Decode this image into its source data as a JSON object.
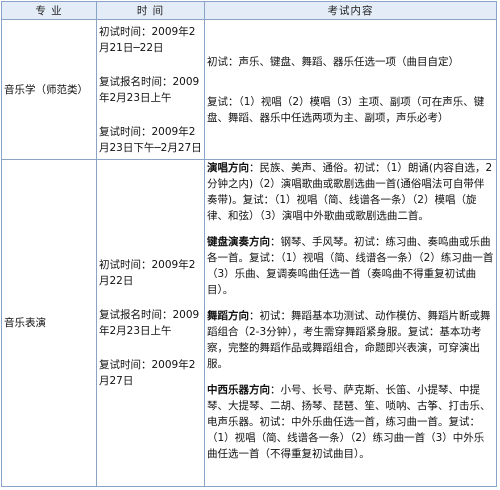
{
  "header": {
    "col_major": "专    业",
    "col_time": "时    间",
    "col_content": "考试内容"
  },
  "rows": [
    {
      "major": "音乐学（师范类）",
      "times": [
        "初试时间：2009年2月21日─22日",
        "复试报名时间：2009年2月23日上午",
        "复试时间：2009年2月23日下午─2月27日"
      ],
      "content": [
        "初试：声乐、键盘、舞蹈、器乐任选一项（曲目自定）",
        "复试：（1）视唱（2）模唱（3）主项、副项（可在声乐、键盘、舞蹈、器乐中任选两项为主、副项，声乐必考）"
      ]
    },
    {
      "major": "音乐表演",
      "times": [
        "初试时间：2009年2月22日",
        "复试报名时间：2009年2月23日上午",
        "复试时间：2009年2月27日"
      ],
      "sections": [
        {
          "title": "演唱方向",
          "text": "：民族、美声、通俗。初试：（1）朗诵(内容自选，2分钟之内)（2）演唱歌曲或歌剧选曲一首(通俗唱法可自带伴奏带)。复试：（1）视唱（简、线谱各一条）（2）模唱（旋律、和弦）（3）演唱中外歌曲或歌剧选曲二首。"
        },
        {
          "title": "键盘演奏方向",
          "text": "：钢琴、手风琴。初试：练习曲、奏鸣曲或乐曲各一首。复试：（1）视唱（简、线谱各一条）（2）练习曲一首（3）乐曲、复调奏鸣曲任选一首（奏鸣曲不得重复初试曲目）。"
        },
        {
          "title": "舞蹈方向",
          "text": "：初试：舞蹈基本功测试、动作模仿、舞蹈片断或舞蹈组合（2-3分钟），考生需穿舞蹈紧身服。复试：基本功考察，完整的舞蹈作品或舞蹈组合，命题即兴表演，可穿演出服。"
        },
        {
          "title": "中西乐器方向",
          "text": "：小号、长号、萨克斯、长笛、小提琴、中提琴、大提琴、二胡、扬琴、琵琶、笙、唢呐、古筝、打击乐、电声乐器。初试：中外乐曲任选一首，练习曲一首。复试：（1）视唱（简、线谱各一条）（2）练习曲一首（3）中外乐曲任选一首（不得重复初试曲目）。"
        }
      ]
    }
  ]
}
